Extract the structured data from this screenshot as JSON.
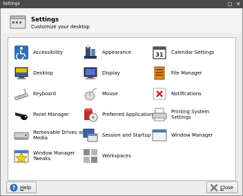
{
  "window": {
    "title": "Settings",
    "maximize_glyph": "□",
    "close_glyph": "✕"
  },
  "header": {
    "title": "Settings",
    "subtitle": "Customize your desktop",
    "icon": "settings-manager-icon"
  },
  "items": [
    {
      "label": "Accessibility",
      "icon": "accessibility-icon"
    },
    {
      "label": "Appearance",
      "icon": "appearance-icon"
    },
    {
      "label": "Calendar Settings",
      "icon": "calendar-icon",
      "icon_text": "31"
    },
    {
      "label": "Desktop",
      "icon": "desktop-icon"
    },
    {
      "label": "Display",
      "icon": "display-icon"
    },
    {
      "label": "File Manager",
      "icon": "file-manager-icon"
    },
    {
      "label": "Keyboard",
      "icon": "keyboard-icon"
    },
    {
      "label": "Mouse",
      "icon": "mouse-icon"
    },
    {
      "label": "Notifications",
      "icon": "notifications-icon"
    },
    {
      "label": "Panel Manager",
      "icon": "panel-manager-icon"
    },
    {
      "label": "Preferred Applications",
      "icon": "preferred-applications-icon"
    },
    {
      "label": "Printing System Settings",
      "icon": "printer-icon"
    },
    {
      "label": "Removable Drives and Media",
      "icon": "removable-drives-icon"
    },
    {
      "label": "Session and Startup",
      "icon": "session-startup-icon"
    },
    {
      "label": "Window Manager",
      "icon": "window-manager-icon"
    },
    {
      "label": "Window Manager Tweaks",
      "icon": "window-manager-tweaks-icon"
    },
    {
      "label": "Workspaces",
      "icon": "workspaces-icon"
    }
  ],
  "buttons": {
    "help": {
      "mnemonic": "H",
      "rest": "elp",
      "icon": "help-icon"
    },
    "close": {
      "mnemonic": "C",
      "rest": "lose",
      "icon": "close-icon"
    }
  }
}
